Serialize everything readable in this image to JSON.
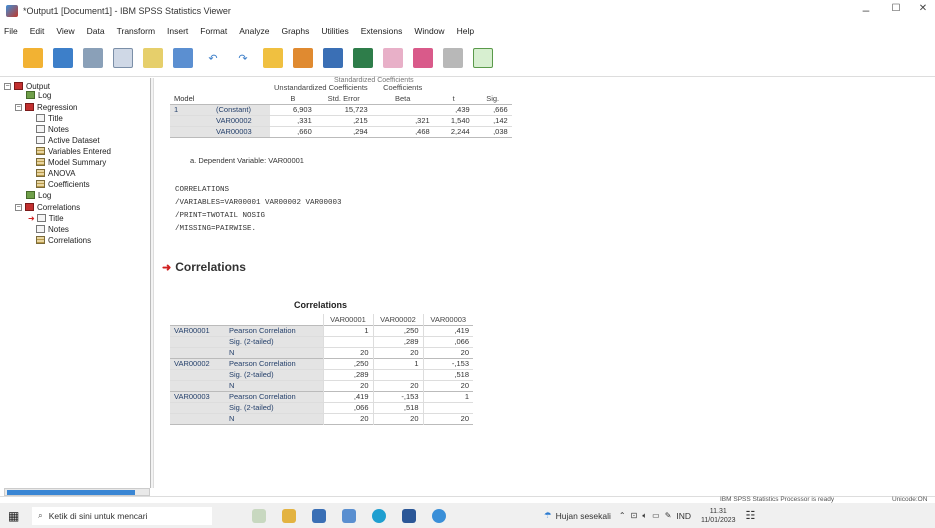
{
  "window": {
    "title": "*Output1 [Document1] - IBM SPSS Statistics Viewer",
    "controls": [
      "–",
      "☐",
      "✕"
    ]
  },
  "menu": [
    "File",
    "Edit",
    "View",
    "Data",
    "Transform",
    "Insert",
    "Format",
    "Analyze",
    "Graphs",
    "Utilities",
    "Extensions",
    "Window",
    "Help"
  ],
  "outline": {
    "items": [
      {
        "label": "Output",
        "icon": "output-book-icon"
      },
      {
        "label": "Log",
        "icon": "log-icon"
      },
      {
        "label": "Regression",
        "icon": "book-icon"
      },
      {
        "label": "Title",
        "icon": "title-icon"
      },
      {
        "label": "Notes",
        "icon": "notes-icon"
      },
      {
        "label": "Active Dataset",
        "icon": "dataset-icon"
      },
      {
        "label": "Variables Entered",
        "icon": "table-icon"
      },
      {
        "label": "Model Summary",
        "icon": "table-icon"
      },
      {
        "label": "ANOVA",
        "icon": "table-icon"
      },
      {
        "label": "Coefficients",
        "icon": "table-icon"
      },
      {
        "label": "Log",
        "icon": "log-icon"
      },
      {
        "label": "Correlations",
        "icon": "book-icon"
      },
      {
        "label": "Title",
        "icon": "title-icon"
      },
      {
        "label": "Notes",
        "icon": "notes-icon"
      },
      {
        "label": "Correlations",
        "icon": "table-icon"
      }
    ]
  },
  "coefficients": {
    "top_label_1": "Unstandardized Coefficients",
    "top_label_2": "Coefficients",
    "top_label_3": "Standardized Coefficients",
    "headers": [
      "Model",
      "",
      "B",
      "Std. Error",
      "Beta",
      "t",
      "Sig."
    ],
    "rows": [
      [
        "1",
        "(Constant)",
        "6,903",
        "15,723",
        "",
        ",439",
        ",666"
      ],
      [
        "",
        "VAR00002",
        ",331",
        ",215",
        ",321",
        "1,540",
        ",142"
      ],
      [
        "",
        "VAR00003",
        ",660",
        ",294",
        ",468",
        "2,244",
        ",038"
      ]
    ],
    "footnote": "a. Dependent Variable: VAR00001"
  },
  "syntax": [
    "CORRELATIONS",
    "  /VARIABLES=VAR00001 VAR00002 VAR00003",
    "  /PRINT=TWOTAIL NOSIG",
    "  /MISSING=PAIRWISE."
  ],
  "correlations": {
    "section_title": "Correlations",
    "table_title": "Correlations",
    "columns": [
      "VAR00001",
      "VAR00002",
      "VAR00003"
    ],
    "rows": [
      [
        "VAR00001",
        "Pearson Correlation",
        "1",
        ",250",
        ",419"
      ],
      [
        "",
        "Sig. (2-tailed)",
        "",
        ",289",
        ",066"
      ],
      [
        "",
        "N",
        "20",
        "20",
        "20"
      ],
      [
        "VAR00002",
        "Pearson Correlation",
        ",250",
        "1",
        "-,153"
      ],
      [
        "",
        "Sig. (2-tailed)",
        ",289",
        "",
        ",518"
      ],
      [
        "",
        "N",
        "20",
        "20",
        "20"
      ],
      [
        "VAR00003",
        "Pearson Correlation",
        ",419",
        "-,153",
        "1"
      ],
      [
        "",
        "Sig. (2-tailed)",
        ",066",
        ",518",
        ""
      ],
      [
        "",
        "N",
        "20",
        "20",
        "20"
      ]
    ]
  },
  "status": {
    "processor": "IBM SPSS Statistics Processor is ready",
    "encoding": "Unicode:ON"
  },
  "taskbar": {
    "search_placeholder": "Ketik di sini untuk mencari",
    "weather": "Hujan sesekali",
    "lang": "IND",
    "time": "11.31",
    "date": "11/01/2023"
  }
}
